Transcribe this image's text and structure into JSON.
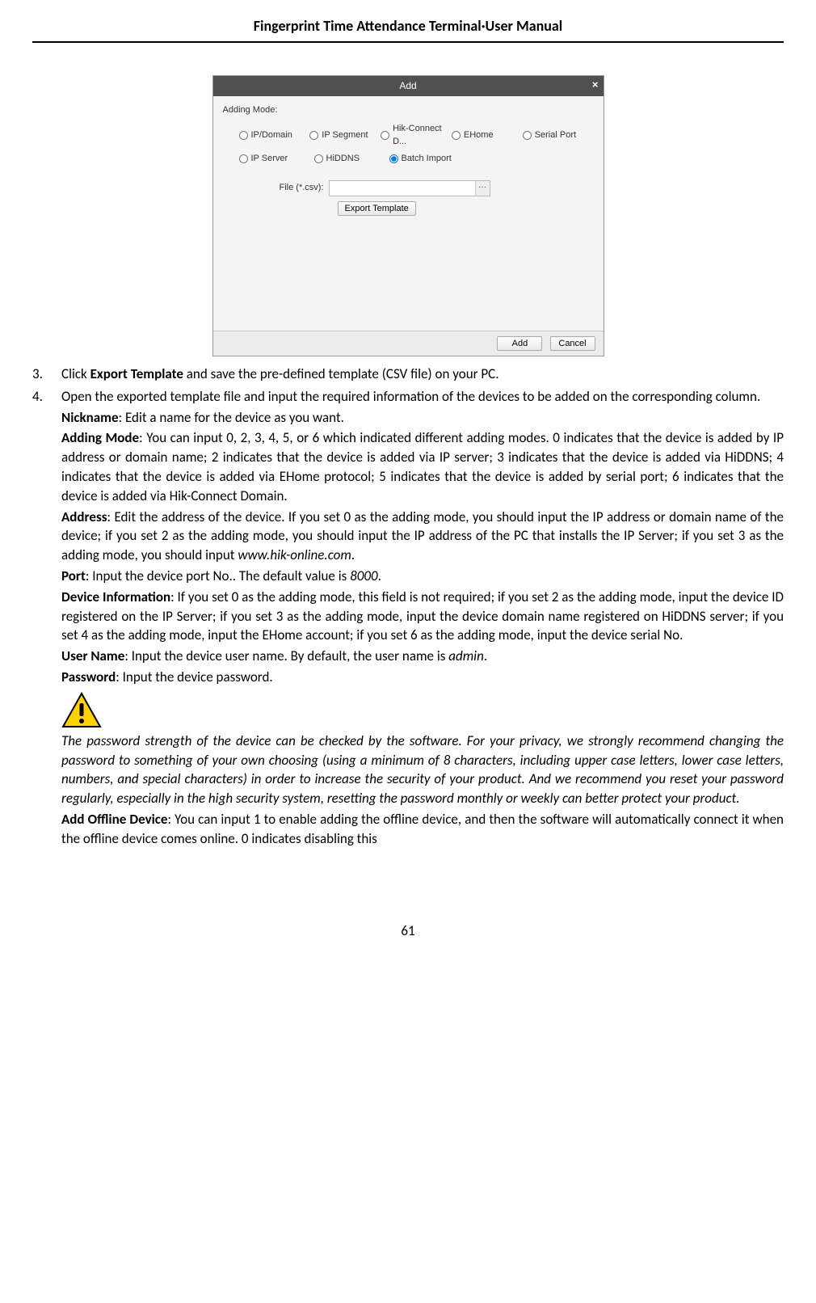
{
  "header": {
    "title": "Fingerprint Time Attendance Terminal·User Manual"
  },
  "dialog": {
    "title": "Add",
    "close": "×",
    "adding_mode_label": "Adding Mode:",
    "radios_row1": [
      "IP/Domain",
      "IP Segment",
      "Hik-Connect D...",
      "EHome",
      "Serial Port"
    ],
    "radios_row2": [
      "IP Server",
      "HiDDNS",
      "Batch Import"
    ],
    "selected_radio": "Batch Import",
    "file_label": "File (*.csv):",
    "file_value": "",
    "browse_label": "···",
    "export_template_btn": "Export Template",
    "footer_add": "Add",
    "footer_cancel": "Cancel"
  },
  "steps": {
    "s3_prefix": "Click ",
    "s3_bold": "Export Template",
    "s3_suffix": " and save the pre-defined template (CSV file) on your PC.",
    "s4_line1": "Open the exported template file and input the required information of the devices to be added on the corresponding column.",
    "nickname_label": "Nickname",
    "nickname_text": ": Edit a name for the device as you want.",
    "adding_mode_label": "Adding Mode",
    "adding_mode_text": ": You can input 0, 2, 3, 4, 5, or 6 which indicated different adding modes. 0 indicates that the device is added by IP address or domain name; 2 indicates that the device is added via IP server; 3 indicates that the device is added via HiDDNS; 4 indicates that the device is added via EHome protocol; 5 indicates that the device is added by serial port; 6 indicates that the device is added via Hik-Connect Domain.",
    "address_label": "Address",
    "address_text_a": ": Edit the address of the device. If you set 0 as the adding mode, you should input the IP address or domain name of the device; if you set 2 as the adding mode, you should input the IP address of the PC that installs the IP Server; if you set 3 as the adding mode, you should input ",
    "address_italic": "www.hik-online.com",
    "address_text_b": ".",
    "port_label": "Port",
    "port_text_a": ": Input the device port No.. The default value is ",
    "port_italic": "8000",
    "port_text_b": ".",
    "device_info_label": "Device Information",
    "device_info_text": ": If you set 0 as the adding mode, this field is not required; if you set 2 as the adding mode, input the device ID registered on the IP Server; if you set 3 as the adding mode, input the device domain name registered on HiDDNS server; if you set 4 as the adding mode, input the EHome account; if you set 6 as the adding mode, input the device serial No.",
    "user_name_label": "User Name",
    "user_name_text_a": ": Input the device user name. By default, the user name is ",
    "user_name_italic": "admin",
    "user_name_text_b": ".",
    "password_label": "Password",
    "password_text": ": Input the device password.",
    "warning_text": "The password strength of the device can be checked by the software. For your privacy, we strongly recommend changing the password to something of your own choosing (using a minimum of 8 characters, including upper case letters, lower case letters, numbers, and special characters) in order to increase the security of your product. And we recommend you reset your password regularly, especially in the high security system, resetting the password monthly or weekly can better protect your product.",
    "offline_label": "Add Offline Device",
    "offline_text": ": You can input 1 to enable adding the offline device, and then the software will automatically connect it when the offline device comes online. 0 indicates disabling this"
  },
  "page_number": "61"
}
